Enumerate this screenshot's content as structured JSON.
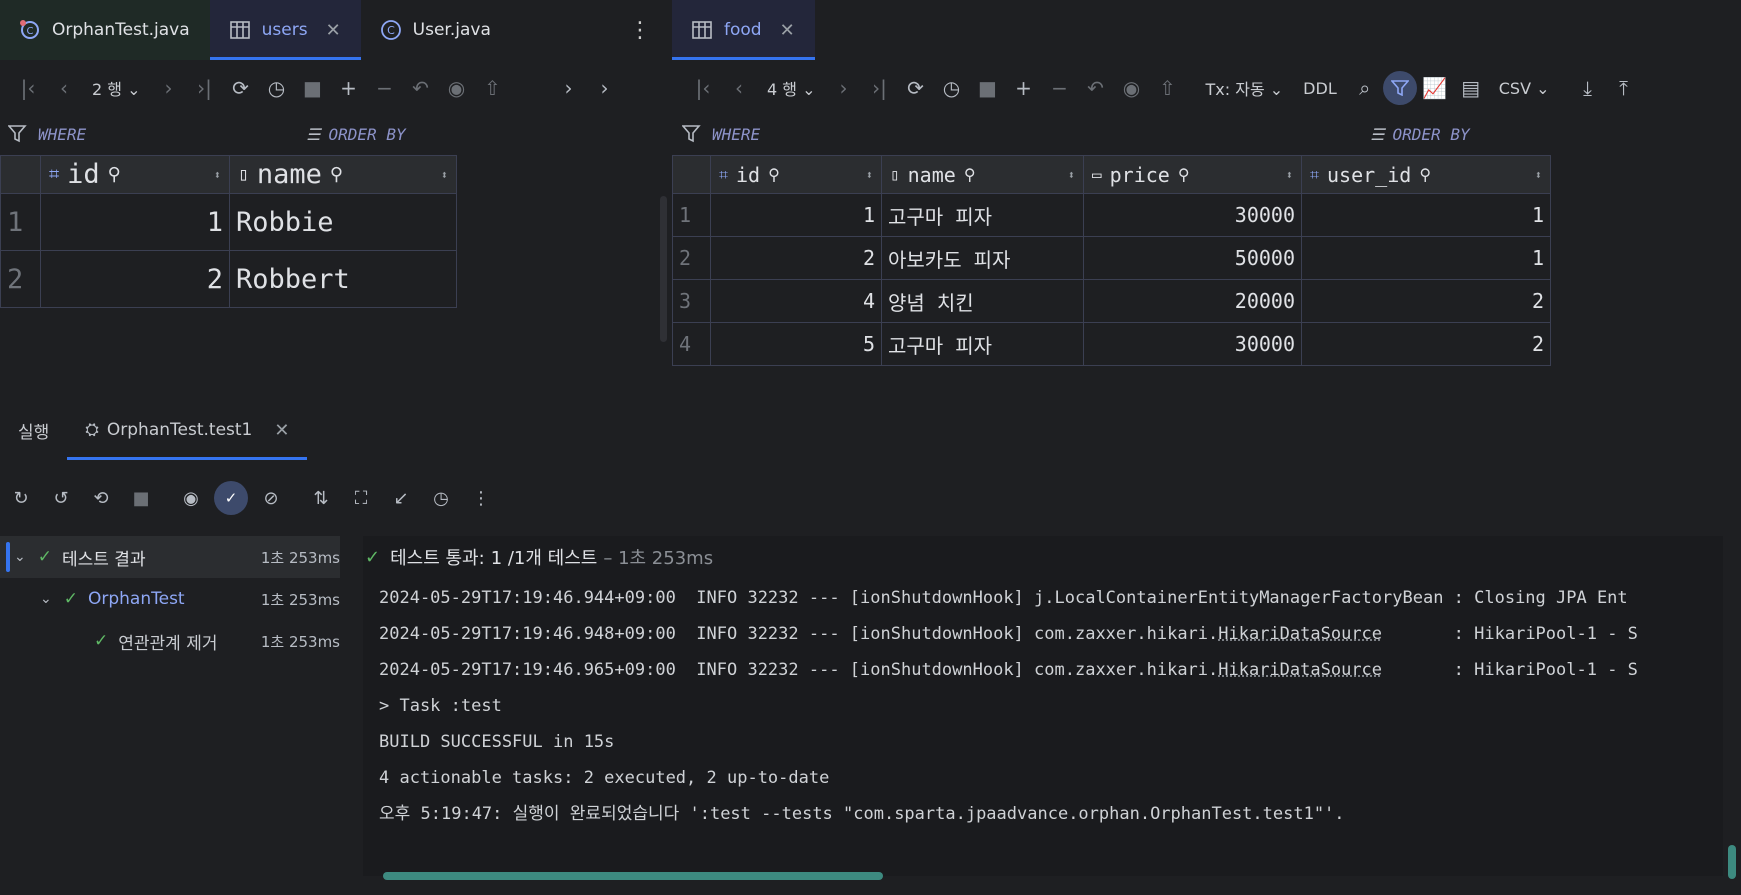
{
  "editor_tabs_left": [
    {
      "label": "OrphanTest.java",
      "icon": "java-test-class-icon",
      "active": false
    },
    {
      "label": "users",
      "icon": "table-icon",
      "active": true,
      "closable": true
    },
    {
      "label": "User.java",
      "icon": "class-icon",
      "active": false
    }
  ],
  "editor_tabs_right": [
    {
      "label": "food",
      "icon": "table-icon",
      "active": true,
      "closable": true
    }
  ],
  "users_toolbar": {
    "row_count": "2 행"
  },
  "food_toolbar": {
    "row_count": "4 행",
    "tx_mode": "Tx: 자동",
    "ddl": "DDL",
    "export_format": "CSV"
  },
  "filter": {
    "where": "WHERE",
    "order_by": "ORDER BY"
  },
  "users_table": {
    "columns": [
      "id",
      "name"
    ],
    "rows": [
      {
        "rownum": "1",
        "id": "1",
        "name": "Robbie"
      },
      {
        "rownum": "2",
        "id": "2",
        "name": "Robbert"
      }
    ]
  },
  "food_table": {
    "columns": [
      "id",
      "name",
      "price",
      "user_id"
    ],
    "rows": [
      {
        "rownum": "1",
        "id": "1",
        "name": "고구마 피자",
        "price": "30000",
        "user_id": "1"
      },
      {
        "rownum": "2",
        "id": "2",
        "name": "아보카도 피자",
        "price": "50000",
        "user_id": "1"
      },
      {
        "rownum": "3",
        "id": "4",
        "name": "양념 치킨",
        "price": "20000",
        "user_id": "2"
      },
      {
        "rownum": "4",
        "id": "5",
        "name": "고구마 피자",
        "price": "30000",
        "user_id": "2"
      }
    ]
  },
  "run_panel": {
    "tab_run": "실행",
    "tab_config": "OrphanTest.test1",
    "status_prefix": "테스트 통과:",
    "status_count": "1 /1개 테스트",
    "status_time": "– 1초 253ms"
  },
  "test_tree": [
    {
      "label": "테스트 결과",
      "time": "1초 253ms"
    },
    {
      "label": "OrphanTest",
      "time": "1초 253ms"
    },
    {
      "label": "연관관계 제거",
      "time": "1초 253ms"
    }
  ],
  "console_lines": {
    "l1": "2024-05-29T17:19:46.944+09:00  INFO 32232 --- [ionShutdownHook] j.LocalContainerEntityManagerFactoryBean : Closing JPA Ent",
    "l2a": "2024-05-29T17:19:46.948+09:00  INFO 32232 --- [ionShutdownHook] com.zaxxer.hikari.",
    "l2b": "HikariDataSource",
    "l2c": "       : HikariPool-1 - S",
    "l3a": "2024-05-29T17:19:46.965+09:00  INFO 32232 --- [ionShutdownHook] com.zaxxer.hikari.",
    "l3b": "HikariDataSource",
    "l3c": "       : HikariPool-1 - S",
    "l4": "> Task :test",
    "l5": "BUILD SUCCESSFUL in 15s",
    "l6": "4 actionable tasks: 2 executed, 2 up-to-date",
    "l7": "오후 5:19:47: 실행이 완료되었습니다 ':test --tests \"com.sparta.jpaadvance.orphan.OrphanTest.test1\"'."
  },
  "colors": {
    "accent": "#3574f0",
    "success": "#5fb865",
    "background": "#1e1f22"
  }
}
